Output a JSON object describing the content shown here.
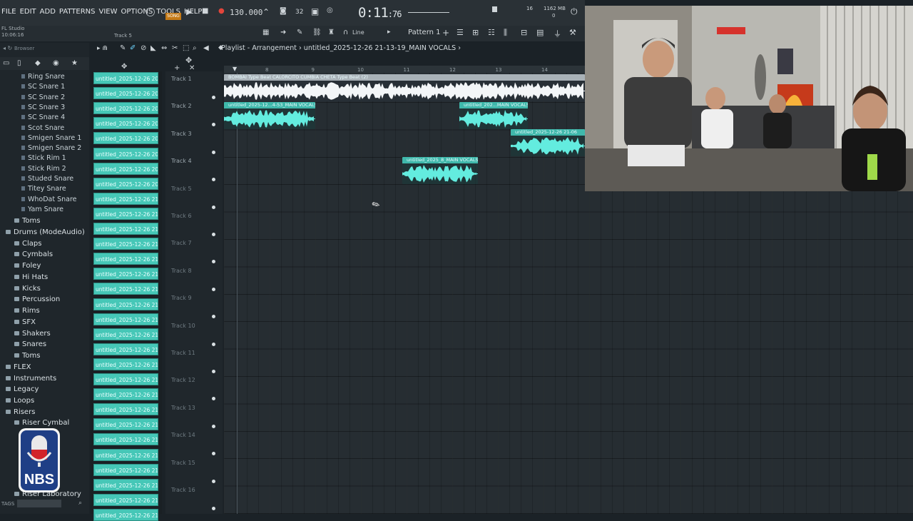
{
  "menu": [
    "FILE",
    "EDIT",
    "ADD",
    "PATTERNS",
    "VIEW",
    "OPTIONS",
    "TOOLS",
    "HELP"
  ],
  "transport": {
    "tempo": "130.000",
    "time_main": "0:11",
    "time_sub": "76",
    "song_label": "SONG",
    "memory": "1162 MB",
    "memory_sub": "0",
    "voices": "16",
    "bars_label": "32"
  },
  "app": {
    "name": "FL Studio",
    "clock": "10:06:16",
    "hint_track": "Track 5"
  },
  "toolbar": {
    "snap": "Line",
    "pattern": "Pattern 1"
  },
  "browser": {
    "title": "Browser",
    "tags_label": "TAGS",
    "items": [
      {
        "label": "Ring Snare",
        "kind": "wav"
      },
      {
        "label": "SC Snare 1",
        "kind": "wav"
      },
      {
        "label": "SC Snare 2",
        "kind": "wav"
      },
      {
        "label": "SC Snare 3",
        "kind": "wav"
      },
      {
        "label": "SC Snare 4",
        "kind": "wav"
      },
      {
        "label": "Scot Snare",
        "kind": "wav"
      },
      {
        "label": "Smigen Snare 1",
        "kind": "wav"
      },
      {
        "label": "Smigen Snare 2",
        "kind": "wav"
      },
      {
        "label": "Stick Rim 1",
        "kind": "wav"
      },
      {
        "label": "Stick Rim 2",
        "kind": "wav"
      },
      {
        "label": "Studed Snare",
        "kind": "wav"
      },
      {
        "label": "Titey Snare",
        "kind": "wav"
      },
      {
        "label": "WhoDat Snare",
        "kind": "wav"
      },
      {
        "label": "Yam Snare",
        "kind": "wav"
      },
      {
        "label": "Toms",
        "kind": "folder"
      },
      {
        "label": "Drums (ModeAudio)",
        "kind": "folder"
      },
      {
        "label": "Claps",
        "kind": "folder"
      },
      {
        "label": "Cymbals",
        "kind": "folder"
      },
      {
        "label": "Foley",
        "kind": "folder"
      },
      {
        "label": "Hi Hats",
        "kind": "folder"
      },
      {
        "label": "Kicks",
        "kind": "folder"
      },
      {
        "label": "Percussion",
        "kind": "folder"
      },
      {
        "label": "Rims",
        "kind": "folder"
      },
      {
        "label": "SFX",
        "kind": "folder"
      },
      {
        "label": "Shakers",
        "kind": "folder"
      },
      {
        "label": "Snares",
        "kind": "folder"
      },
      {
        "label": "Toms",
        "kind": "folder"
      },
      {
        "label": "FLEX",
        "kind": "folder"
      },
      {
        "label": "Instruments",
        "kind": "folder"
      },
      {
        "label": "Legacy",
        "kind": "folder"
      },
      {
        "label": "Loops",
        "kind": "folder"
      },
      {
        "label": "Risers",
        "kind": "folder"
      },
      {
        "label": "Riser Cymbal",
        "kind": "folder"
      },
      {
        "label": "Riser Laboratory",
        "kind": "folder"
      }
    ]
  },
  "picker_clips": [
    "untitled_2025-12-26 20-",
    "untitled_2025-12-26 20-",
    "untitled_2025-12-26 20-",
    "untitled_2025-12-26 20-",
    "untitled_2025-12-26 20-",
    "untitled_2025-12-26 20-",
    "untitled_2025-12-26 20-",
    "untitled_2025-12-26 20-",
    "untitled_2025-12-26 21-",
    "untitled_2025-12-26 21-",
    "untitled_2025-12-26 21-",
    "untitled_2025-12-26 21-",
    "untitled_2025-12-26 21-",
    "untitled_2025-12-26 21-",
    "untitled_2025-12-26 21-",
    "untitled_2025-12-26 21-",
    "untitled_2025-12-26 21-",
    "untitled_2025-12-26 21-",
    "untitled_2025-12-26 21-",
    "untitled_2025-12-26 21-",
    "untitled_2025-12-26 21-",
    "untitled_2025-12-26 21-",
    "untitled_2025-12-26 21-",
    "untitled_2025-12-26 21-",
    "untitled_2025-12-26 21-",
    "untitled_2025-12-26 21-",
    "untitled_2025-12-26 21-",
    "untitled_2025-12-26 21-",
    "untitled_2025-12-26 21-",
    "untitled_2025-12-26 21-"
  ],
  "playlist": {
    "title": "Playlist - Arrangement",
    "breadcrumb": "untitled_2025-12-26 21-13-19_MAIN VOCALS",
    "ruler": [
      "8",
      "9",
      "10",
      "11",
      "12",
      "13",
      "14"
    ],
    "tracks": [
      "Track 1",
      "Track 2",
      "Track 3",
      "Track 4",
      "Track 5",
      "Track 6",
      "Track 7",
      "Track 8",
      "Track 9",
      "Track 10",
      "Track 11",
      "Track 12",
      "Track 13",
      "Track 14",
      "Track 15",
      "Track 16"
    ],
    "clips": [
      {
        "name": "BOMBAI Type Beat CALORCITO CUMBIA CHETA Type Beat (2)",
        "color": "#a9b2b8",
        "wave": "#f3f6f8"
      },
      {
        "name": "untitled_2025-12...4-53_MAIN VOCALS",
        "color": "#3fb8ab",
        "wave": "#63ecdf"
      },
      {
        "name": "untitled_202...MAIN VOCALS",
        "color": "#3fb8ab",
        "wave": "#63ecdf"
      },
      {
        "name": "untitled_2025-12-26 21-06",
        "color": "#3fb8ab",
        "wave": "#63ecdf"
      },
      {
        "name": "untitled_2025_8_MAIN VOCALS",
        "color": "#3fb8ab",
        "wave": "#63ecdf"
      }
    ]
  },
  "colors": {
    "accent": "#46c7b7",
    "background": "#1b2227"
  }
}
